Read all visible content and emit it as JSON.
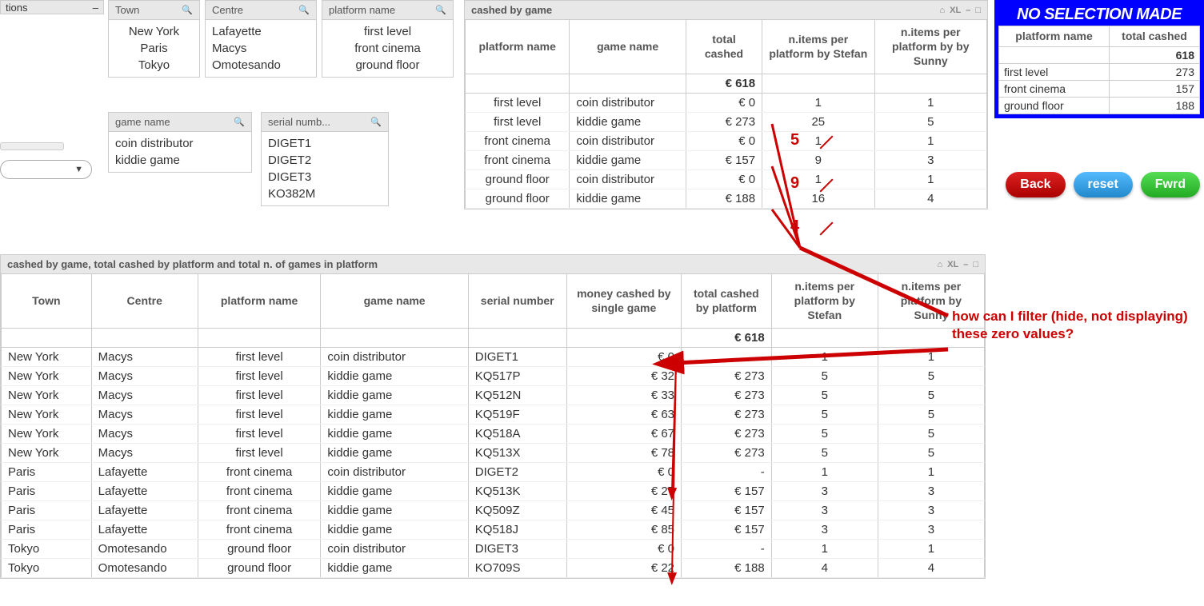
{
  "sidebar_actions": {
    "title": "tions",
    "min": "–"
  },
  "filters": {
    "town": {
      "title": "Town",
      "items": [
        "New York",
        "Paris",
        "Tokyo"
      ]
    },
    "centre": {
      "title": "Centre",
      "items": [
        "Lafayette",
        "Macys",
        "Omotesando"
      ]
    },
    "platform_name": {
      "title": "platform name",
      "items": [
        "first level",
        "front cinema",
        "ground floor"
      ]
    },
    "game_name": {
      "title": "game name",
      "items": [
        "coin distributor",
        "kiddie game"
      ]
    },
    "serial_num": {
      "title": "serial numb...",
      "items": [
        "DIGET1",
        "DIGET2",
        "DIGET3",
        "KO382M"
      ]
    }
  },
  "cashed_by_game": {
    "title": "cashed by game",
    "ctrls": [
      "⌂",
      "XL",
      "–",
      "□"
    ],
    "cols": [
      "platform name",
      "game name",
      "total cashed",
      "n.items per platform by Stefan",
      "n.items per platform by by Sunny"
    ],
    "total_cashed": "€ 618",
    "rows": [
      {
        "platform": "first level",
        "game": "coin distributor",
        "cash": "€ 0",
        "stefan": "1",
        "sunny": "1"
      },
      {
        "platform": "first level",
        "game": "kiddie game",
        "cash": "€ 273",
        "stefan": "25",
        "sunny": "5"
      },
      {
        "platform": "front cinema",
        "game": "coin distributor",
        "cash": "€ 0",
        "stefan": "1",
        "sunny": "1"
      },
      {
        "platform": "front cinema",
        "game": "kiddie game",
        "cash": "€ 157",
        "stefan": "9",
        "sunny": "3"
      },
      {
        "platform": "ground floor",
        "game": "coin distributor",
        "cash": "€ 0",
        "stefan": "1",
        "sunny": "1"
      },
      {
        "platform": "ground floor",
        "game": "kiddie game",
        "cash": "€ 188",
        "stefan": "16",
        "sunny": "4"
      }
    ]
  },
  "annotations": {
    "corrections": [
      {
        "val": "5"
      },
      {
        "val": "9"
      },
      {
        "val": "4"
      }
    ],
    "question": "how can I filter (hide, not displaying) these zero values?"
  },
  "side_panel": {
    "hdr": "NO SELECTION MADE",
    "cols": [
      "platform name",
      "total cashed"
    ],
    "total": "618",
    "rows": [
      {
        "p": "first level",
        "c": "273"
      },
      {
        "p": "front cinema",
        "c": "157"
      },
      {
        "p": "ground floor",
        "c": "188"
      }
    ]
  },
  "buttons": {
    "back": "Back",
    "reset": "reset",
    "fwrd": "Fwrd"
  },
  "detail": {
    "title": "cashed by game, total cashed by platform and total n. of games in platform",
    "ctrls": [
      "⌂",
      "XL",
      "–",
      "□"
    ],
    "cols": [
      "Town",
      "Centre",
      "platform name",
      "game name",
      "serial number",
      "money cashed by single game",
      "total cashed by platform",
      "n.items per platform by Stefan",
      "n.items per platform by Sunny"
    ],
    "total_cashed": "€ 618",
    "rows": [
      {
        "t": "New York",
        "c": "Macys",
        "p": "first level",
        "g": "coin distributor",
        "s": "DIGET1",
        "m": "€ 0",
        "tc": "-",
        "st": "1",
        "su": "1"
      },
      {
        "t": "New York",
        "c": "Macys",
        "p": "first level",
        "g": "kiddie game",
        "s": "KQ517P",
        "m": "€ 32",
        "tc": "€ 273",
        "st": "5",
        "su": "5"
      },
      {
        "t": "New York",
        "c": "Macys",
        "p": "first level",
        "g": "kiddie game",
        "s": "KQ512N",
        "m": "€ 33",
        "tc": "€ 273",
        "st": "5",
        "su": "5"
      },
      {
        "t": "New York",
        "c": "Macys",
        "p": "first level",
        "g": "kiddie game",
        "s": "KQ519F",
        "m": "€ 63",
        "tc": "€ 273",
        "st": "5",
        "su": "5"
      },
      {
        "t": "New York",
        "c": "Macys",
        "p": "first level",
        "g": "kiddie game",
        "s": "KQ518A",
        "m": "€ 67",
        "tc": "€ 273",
        "st": "5",
        "su": "5"
      },
      {
        "t": "New York",
        "c": "Macys",
        "p": "first level",
        "g": "kiddie game",
        "s": "KQ513X",
        "m": "€ 78",
        "tc": "€ 273",
        "st": "5",
        "su": "5"
      },
      {
        "t": "Paris",
        "c": "Lafayette",
        "p": "front cinema",
        "g": "coin distributor",
        "s": "DIGET2",
        "m": "€ 0",
        "tc": "-",
        "st": "1",
        "su": "1"
      },
      {
        "t": "Paris",
        "c": "Lafayette",
        "p": "front cinema",
        "g": "kiddie game",
        "s": "KQ513K",
        "m": "€ 27",
        "tc": "€ 157",
        "st": "3",
        "su": "3"
      },
      {
        "t": "Paris",
        "c": "Lafayette",
        "p": "front cinema",
        "g": "kiddie game",
        "s": "KQ509Z",
        "m": "€ 45",
        "tc": "€ 157",
        "st": "3",
        "su": "3"
      },
      {
        "t": "Paris",
        "c": "Lafayette",
        "p": "front cinema",
        "g": "kiddie game",
        "s": "KQ518J",
        "m": "€ 85",
        "tc": "€ 157",
        "st": "3",
        "su": "3"
      },
      {
        "t": "Tokyo",
        "c": "Omotesando",
        "p": "ground floor",
        "g": "coin distributor",
        "s": "DIGET3",
        "m": "€ 0",
        "tc": "-",
        "st": "1",
        "su": "1"
      },
      {
        "t": "Tokyo",
        "c": "Omotesando",
        "p": "ground floor",
        "g": "kiddie game",
        "s": "KO709S",
        "m": "€ 22",
        "tc": "€ 188",
        "st": "4",
        "su": "4"
      }
    ]
  }
}
